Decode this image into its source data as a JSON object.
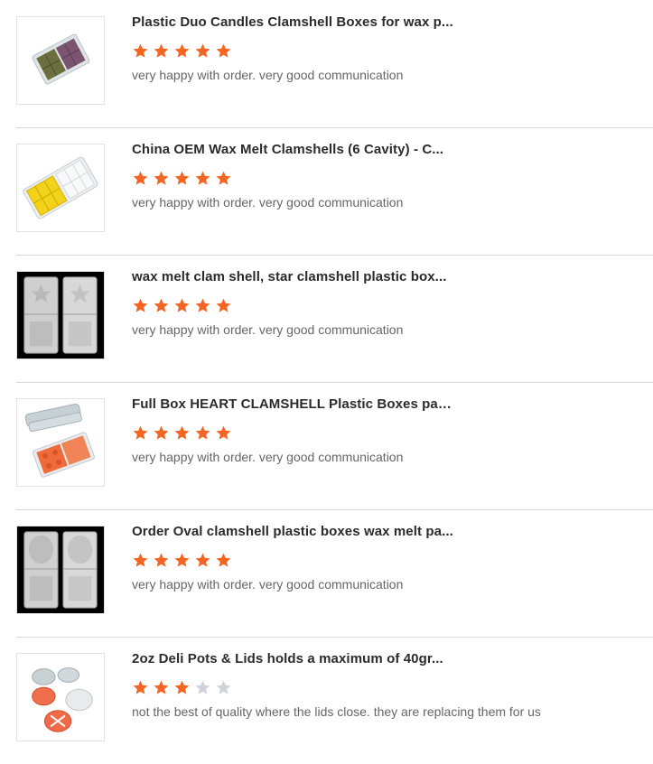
{
  "colors": {
    "star_filled": "#f26522",
    "star_empty": "#cfd3d8",
    "divider": "#d9d9d9"
  },
  "reviews": [
    {
      "title": "Plastic Duo Candles Clamshell Boxes for wax p...",
      "rating": 5,
      "max_rating": 5,
      "comment": "very happy with order. very good communication",
      "image": "duo-clamshell-wax-image"
    },
    {
      "title": "China OEM Wax Melt Clamshells (6 Cavity) - C...",
      "rating": 5,
      "max_rating": 5,
      "comment": "very happy with order. very good communication",
      "image": "six-cavity-clamshell-image"
    },
    {
      "title": "wax melt clam shell, star clamshell plastic box...",
      "rating": 5,
      "max_rating": 5,
      "comment": "very happy with order. very good communication",
      "image": "star-clamshell-image"
    },
    {
      "title": "Full Box HEART CLAMSHELL Plastic Boxes packaging",
      "rating": 5,
      "max_rating": 5,
      "comment": "very happy with order. very good communication",
      "image": "heart-clamshell-image"
    },
    {
      "title": "Order Oval clamshell plastic boxes wax melt pa...",
      "rating": 5,
      "max_rating": 5,
      "comment": "very happy with order. very good communication",
      "image": "oval-clamshell-image"
    },
    {
      "title": "2oz Deli Pots & Lids holds a maximum of 40gr...",
      "rating": 3,
      "max_rating": 5,
      "comment": "not the best of quality where the lids close. they are replacing them for us",
      "image": "deli-pots-image"
    }
  ]
}
